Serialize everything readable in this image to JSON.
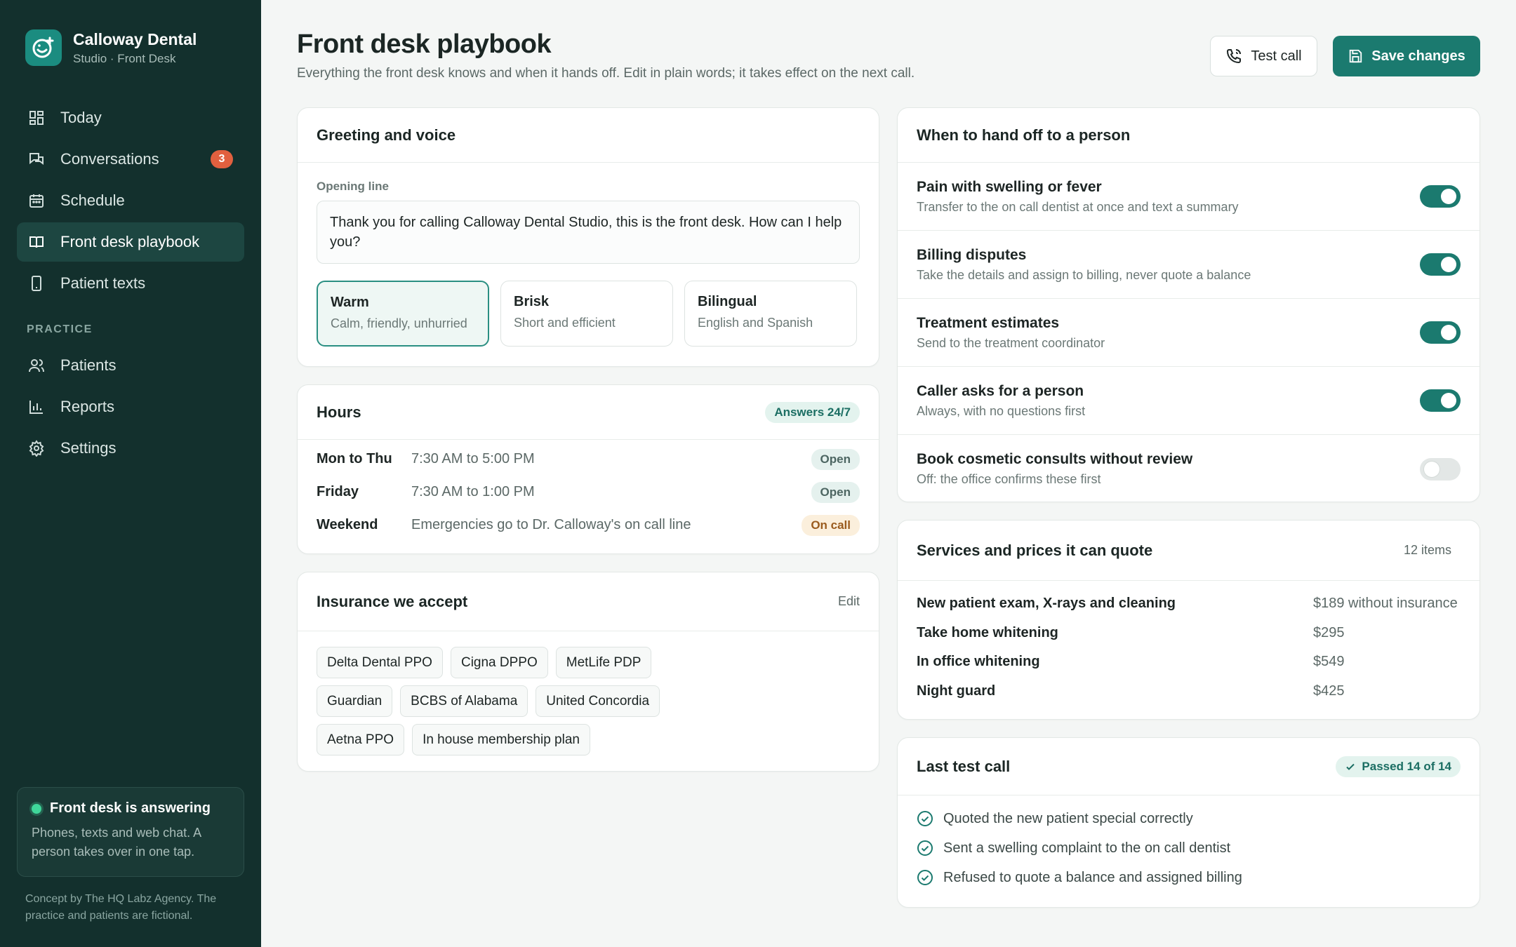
{
  "brand": {
    "name": "Calloway Dental",
    "subtitle": "Studio · Front Desk"
  },
  "nav": {
    "items": [
      {
        "label": "Today",
        "icon": "grid-icon"
      },
      {
        "label": "Conversations",
        "icon": "chat-icon",
        "badge": "3"
      },
      {
        "label": "Schedule",
        "icon": "calendar-icon"
      },
      {
        "label": "Front desk playbook",
        "icon": "book-icon",
        "active": true
      },
      {
        "label": "Patient texts",
        "icon": "phone-icon"
      }
    ],
    "section_label": "PRACTICE",
    "practice_items": [
      {
        "label": "Patients",
        "icon": "users-icon"
      },
      {
        "label": "Reports",
        "icon": "bar-chart-icon"
      },
      {
        "label": "Settings",
        "icon": "gear-icon"
      }
    ]
  },
  "status": {
    "title": "Front desk is answering",
    "description": "Phones, texts and web chat. A person takes over in one tap."
  },
  "footer_note": "Concept by The HQ Labz Agency. The practice and patients are fictional.",
  "header": {
    "title": "Front desk playbook",
    "subtitle": "Everything the front desk knows and when it hands off. Edit in plain words; it takes effect on the next call.",
    "test_call_label": "Test call",
    "save_label": "Save changes"
  },
  "greeting": {
    "title": "Greeting and voice",
    "opening_label": "Opening line",
    "opening_text": "Thank you for calling Calloway Dental Studio, this is the front desk. How can I help you?",
    "tones": [
      {
        "name": "Warm",
        "desc": "Calm, friendly, unhurried",
        "selected": true
      },
      {
        "name": "Brisk",
        "desc": "Short and efficient"
      },
      {
        "name": "Bilingual",
        "desc": "English and Spanish"
      }
    ]
  },
  "hours": {
    "title": "Hours",
    "badge": "Answers 24/7",
    "rows": [
      {
        "day": "Mon to Thu",
        "time": "7:30 AM to 5:00 PM",
        "status": "Open"
      },
      {
        "day": "Friday",
        "time": "7:30 AM to 1:00 PM",
        "status": "Open"
      },
      {
        "day": "Weekend",
        "time": "Emergencies go to Dr. Calloway's on call line",
        "status": "On call"
      }
    ]
  },
  "insurance": {
    "title": "Insurance we accept",
    "edit_label": "Edit",
    "plans": [
      "Delta Dental PPO",
      "Cigna DPPO",
      "MetLife PDP",
      "Guardian",
      "BCBS of Alabama",
      "United Concordia",
      "Aetna PPO",
      "In house membership plan"
    ]
  },
  "handoff": {
    "title": "When to hand off to a person",
    "rules": [
      {
        "title": "Pain with swelling or fever",
        "desc": "Transfer to the on call dentist at once and text a summary",
        "on": true
      },
      {
        "title": "Billing disputes",
        "desc": "Take the details and assign to billing, never quote a balance",
        "on": true
      },
      {
        "title": "Treatment estimates",
        "desc": "Send to the treatment coordinator",
        "on": true
      },
      {
        "title": "Caller asks for a person",
        "desc": "Always, with no questions first",
        "on": true
      },
      {
        "title": "Book cosmetic consults without review",
        "desc": "Off: the office confirms these first",
        "on": false
      }
    ]
  },
  "services": {
    "title": "Services and prices it can quote",
    "count": "12 items",
    "rows": [
      {
        "name": "New patient exam, X-rays and cleaning",
        "price": "$189 without insurance"
      },
      {
        "name": "Take home whitening",
        "price": "$295"
      },
      {
        "name": "In office whitening",
        "price": "$549"
      },
      {
        "name": "Night guard",
        "price": "$425"
      }
    ]
  },
  "last_test": {
    "title": "Last test call",
    "badge": "Passed 14 of 14",
    "checks": [
      "Quoted the new patient special correctly",
      "Sent a swelling complaint to the on call dentist",
      "Refused to quote a balance and assigned billing"
    ]
  },
  "colors": {
    "sidebar": "#13302d",
    "accent": "#1b7a6f",
    "badge": "#e1603f",
    "status_dot": "#3fd69a"
  }
}
